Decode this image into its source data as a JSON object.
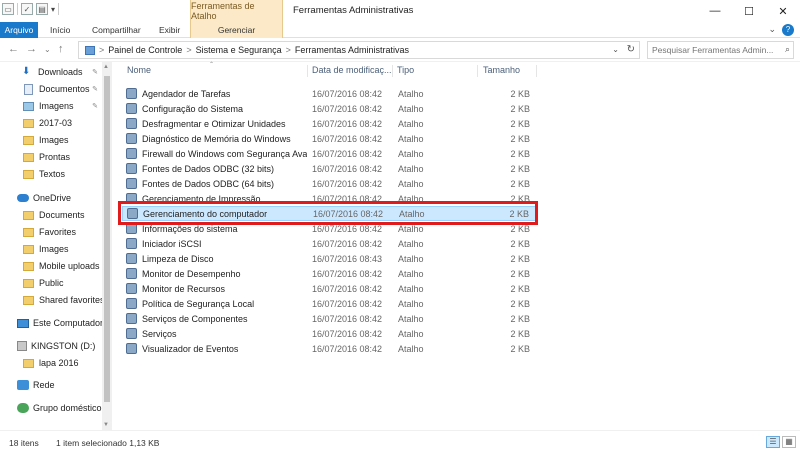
{
  "window": {
    "title": "Ferramentas Administrativas",
    "context_tab_header": "Ferramentas de Atalho",
    "controls": {
      "minimize": "—",
      "maximize": "☐",
      "close": "✕"
    }
  },
  "ribbon": {
    "tabs": [
      "Arquivo",
      "Início",
      "Compartilhar",
      "Exibir",
      "Gerenciar"
    ],
    "help": "?"
  },
  "address": {
    "crumbs": [
      "Painel de Controle",
      "Sistema e Segurança",
      "Ferramentas Administrativas"
    ],
    "separator": ">",
    "search_placeholder": "Pesquisar Ferramentas Admin..."
  },
  "sidebar": {
    "items": [
      {
        "label": "Downloads",
        "icon": "download-icon",
        "pinned": true
      },
      {
        "label": "Documentos",
        "icon": "documents-icon",
        "pinned": true
      },
      {
        "label": "Imagens",
        "icon": "pictures-icon",
        "pinned": true
      },
      {
        "label": "2017-03",
        "icon": "folder-icon"
      },
      {
        "label": "Images",
        "icon": "folder-icon"
      },
      {
        "label": "Prontas",
        "icon": "folder-icon"
      },
      {
        "label": "Textos",
        "icon": "folder-icon"
      },
      {
        "label": "OneDrive",
        "icon": "onedrive-icon"
      },
      {
        "label": "Documents",
        "icon": "folder-icon"
      },
      {
        "label": "Favorites",
        "icon": "folder-icon"
      },
      {
        "label": "Images",
        "icon": "folder-icon"
      },
      {
        "label": "Mobile uploads",
        "icon": "folder-icon"
      },
      {
        "label": "Public",
        "icon": "folder-icon"
      },
      {
        "label": "Shared favorites",
        "icon": "folder-icon"
      },
      {
        "label": "Este Computador",
        "icon": "computer-icon"
      },
      {
        "label": "KINGSTON (D:)",
        "icon": "drive-icon"
      },
      {
        "label": "lapa 2016",
        "icon": "folder-icon"
      },
      {
        "label": "Rede",
        "icon": "network-icon"
      },
      {
        "label": "Grupo doméstico",
        "icon": "homegroup-icon"
      }
    ]
  },
  "list": {
    "columns": {
      "name": "Nome",
      "date": "Data de modificaç...",
      "type": "Tipo",
      "size": "Tamanho"
    },
    "rows": [
      {
        "name": "Agendador de Tarefas",
        "date": "16/07/2016 08:42",
        "type": "Atalho",
        "size": "2 KB"
      },
      {
        "name": "Configuração do Sistema",
        "date": "16/07/2016 08:42",
        "type": "Atalho",
        "size": "2 KB"
      },
      {
        "name": "Desfragmentar e Otimizar Unidades",
        "date": "16/07/2016 08:42",
        "type": "Atalho",
        "size": "2 KB"
      },
      {
        "name": "Diagnóstico de Memória do Windows",
        "date": "16/07/2016 08:42",
        "type": "Atalho",
        "size": "2 KB"
      },
      {
        "name": "Firewall do Windows com Segurança Ava...",
        "date": "16/07/2016 08:42",
        "type": "Atalho",
        "size": "2 KB"
      },
      {
        "name": "Fontes de Dados ODBC (32 bits)",
        "date": "16/07/2016 08:42",
        "type": "Atalho",
        "size": "2 KB"
      },
      {
        "name": "Fontes de Dados ODBC (64 bits)",
        "date": "16/07/2016 08:42",
        "type": "Atalho",
        "size": "2 KB"
      },
      {
        "name": "Gerenciamento de Impressão",
        "date": "16/07/2016 08:42",
        "type": "Atalho",
        "size": "2 KB"
      },
      {
        "name": "Gerenciamento do computador",
        "date": "16/07/2016 08:42",
        "type": "Atalho",
        "size": "2 KB",
        "selected": true
      },
      {
        "name": "Informações do sistema",
        "date": "16/07/2016 08:42",
        "type": "Atalho",
        "size": "2 KB"
      },
      {
        "name": "Iniciador iSCSI",
        "date": "16/07/2016 08:42",
        "type": "Atalho",
        "size": "2 KB"
      },
      {
        "name": "Limpeza de Disco",
        "date": "16/07/2016 08:43",
        "type": "Atalho",
        "size": "2 KB"
      },
      {
        "name": "Monitor de Desempenho",
        "date": "16/07/2016 08:42",
        "type": "Atalho",
        "size": "2 KB"
      },
      {
        "name": "Monitor de Recursos",
        "date": "16/07/2016 08:42",
        "type": "Atalho",
        "size": "2 KB"
      },
      {
        "name": "Política de Segurança Local",
        "date": "16/07/2016 08:42",
        "type": "Atalho",
        "size": "2 KB"
      },
      {
        "name": "Serviços de Componentes",
        "date": "16/07/2016 08:42",
        "type": "Atalho",
        "size": "2 KB"
      },
      {
        "name": "Serviços",
        "date": "16/07/2016 08:42",
        "type": "Atalho",
        "size": "2 KB"
      },
      {
        "name": "Visualizador de Eventos",
        "date": "16/07/2016 08:42",
        "type": "Atalho",
        "size": "2 KB"
      }
    ]
  },
  "status": {
    "item_count": "18 itens",
    "selection": "1 item selecionado  1,13 KB"
  },
  "colors": {
    "accent": "#1979ca",
    "selection": "#cce8ff",
    "highlight": "#e11b1b",
    "context_tab": "#fbe9c8"
  }
}
